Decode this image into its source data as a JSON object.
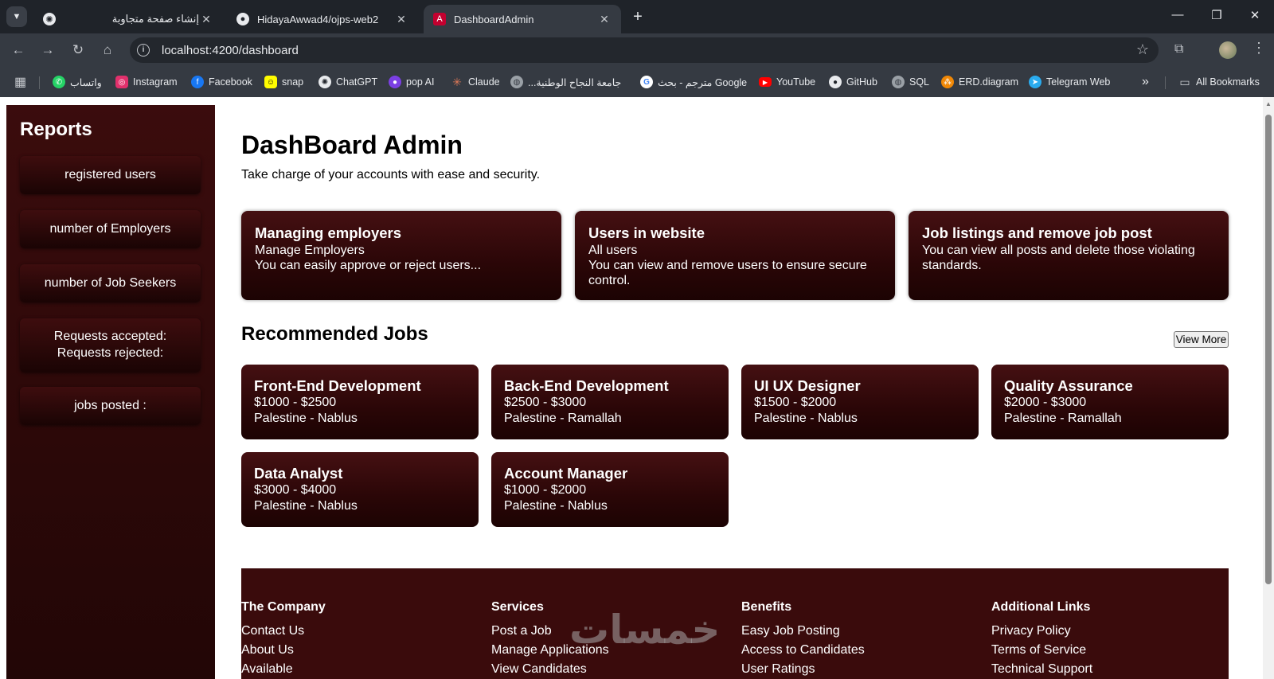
{
  "browser": {
    "tabs": [
      {
        "title": "إنشاء صفحة متجاوبة",
        "favicon": "chatgpt-icon"
      },
      {
        "title": "HidayaAwwad4/ojps-web2",
        "favicon": "github-icon"
      },
      {
        "title": "DashboardAdmin",
        "favicon": "angular-icon",
        "active": true
      }
    ],
    "url": "localhost:4200/dashboard",
    "bookmarks": [
      {
        "label": "واتساب",
        "icon": "whatsapp-icon",
        "color": "#25d366"
      },
      {
        "label": "Instagram",
        "icon": "instagram-icon",
        "color": "#e1306c"
      },
      {
        "label": "Facebook",
        "icon": "facebook-icon",
        "color": "#1877f2"
      },
      {
        "label": "snap",
        "icon": "snapchat-icon",
        "color": "#fffc00"
      },
      {
        "label": "ChatGPT",
        "icon": "chatgpt-icon",
        "color": "#e8eaed"
      },
      {
        "label": "pop AI",
        "icon": "popai-icon",
        "color": "#7b3fe4"
      },
      {
        "label": "Claude",
        "icon": "claude-icon",
        "color": "#d97757"
      },
      {
        "label": "جامعة النجاح الوطنية...",
        "icon": "globe-icon",
        "color": "#9aa0a6"
      },
      {
        "label": "مترجم - بحث Google",
        "icon": "google-icon",
        "color": "#ffffff"
      },
      {
        "label": "YouTube",
        "icon": "youtube-icon",
        "color": "#ff0000"
      },
      {
        "label": "GitHub",
        "icon": "github-icon",
        "color": "#e8eaed"
      },
      {
        "label": "SQL",
        "icon": "globe-icon",
        "color": "#9aa0a6"
      },
      {
        "label": "ERD.diagram",
        "icon": "erd-icon",
        "color": "#f08705"
      },
      {
        "label": "Telegram Web",
        "icon": "telegram-icon",
        "color": "#2aabee"
      }
    ],
    "more_bookmarks": "»",
    "all_bookmarks": "All Bookmarks"
  },
  "sidebar": {
    "title": "Reports",
    "items": [
      {
        "lines": [
          "registered users"
        ]
      },
      {
        "lines": [
          "number of Employers"
        ]
      },
      {
        "lines": [
          "number of Job Seekers"
        ]
      },
      {
        "lines": [
          "Requests accepted:",
          "Requests rejected:"
        ]
      },
      {
        "lines": [
          "jobs posted :"
        ]
      }
    ]
  },
  "main": {
    "title": "DashBoard Admin",
    "subtitle": "Take charge of your accounts with ease and security.",
    "cards": [
      {
        "title": "Managing employers",
        "lines": [
          "Manage Employers",
          "You can easily approve or reject users..."
        ]
      },
      {
        "title": "Users in website",
        "lines": [
          "All users",
          "You can view and remove users to ensure secure control."
        ]
      },
      {
        "title": "Job listings and remove job post",
        "lines": [
          "You can view all posts and delete those violating standards."
        ]
      }
    ],
    "recommended_title": "Recommended Jobs",
    "view_more": "View More",
    "jobs": [
      {
        "title": "Front-End Development",
        "salary": "$1000 - $2500",
        "location": "Palestine - Nablus"
      },
      {
        "title": "Back-End Development",
        "salary": "$2500 - $3000",
        "location": "Palestine - Ramallah"
      },
      {
        "title": "UI UX Designer",
        "salary": "$1500 - $2000",
        "location": "Palestine - Nablus"
      },
      {
        "title": "Quality Assurance",
        "salary": "$2000 - $3000",
        "location": "Palestine - Ramallah"
      },
      {
        "title": "Data Analyst",
        "salary": "$3000 - $4000",
        "location": "Palestine - Nablus"
      },
      {
        "title": "Account Manager",
        "salary": "$1000 - $2000",
        "location": "Palestine - Nablus"
      }
    ]
  },
  "footer": {
    "columns": [
      {
        "heading": "The Company",
        "links": [
          "Contact Us",
          "About Us",
          "Available"
        ]
      },
      {
        "heading": "Services",
        "links": [
          "Post a Job",
          "Manage Applications",
          "View Candidates"
        ]
      },
      {
        "heading": "Benefits",
        "links": [
          "Easy Job Posting",
          "Access to Candidates",
          "User Ratings"
        ]
      },
      {
        "heading": "Additional Links",
        "links": [
          "Privacy Policy",
          "Terms of Service",
          "Technical Support"
        ]
      }
    ]
  },
  "watermark": "خمسات",
  "colors": {
    "brand": "#3a0b0c",
    "card_top": "#451012",
    "card_bottom": "#1c0303"
  }
}
